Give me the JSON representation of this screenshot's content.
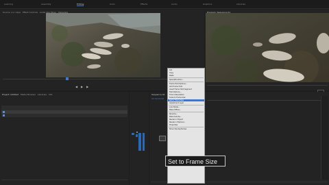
{
  "app": {
    "workspace_tabs": [
      "Learning",
      "Assembly",
      "Editing",
      "Color",
      "Effects",
      "Audio",
      "Graphics",
      "Libraries"
    ],
    "active_tab_index": 2
  },
  "source_monitor": {
    "tabs": [
      "Source: (no clips)",
      "Effect Controls",
      "Audio Clip Mixer",
      "Metadata"
    ]
  },
  "program_monitor": {
    "tabs": [
      "Program: Sequence 01"
    ]
  },
  "project": {
    "tabs": [
      "Project: Untitled",
      "Media Browser",
      "Libraries",
      "Info"
    ]
  },
  "timeline": {
    "tabs": [
      "Sequence 01"
    ],
    "timecode": "00:00:00:00"
  },
  "context_menu": {
    "items": [
      "Cut",
      "Copy",
      "Paste",
      "",
      "Speed/Duration...",
      "",
      "Frame Hold Options...",
      "Add Frame Hold",
      "Insert Frame Hold Segment",
      "Field Options...",
      "Time Interpolation",
      "Scale to Frame Size",
      "Set to Frame Size",
      "Adjustment Layer",
      "",
      "Link Media...",
      "Make Offline...",
      "",
      "Rename...",
      "Make Subclip...",
      "Reveal in Project",
      "Reveal in Explorer...",
      "Properties",
      "",
      "Show Clip Keyframes"
    ],
    "highlighted": "Set to Frame Size"
  },
  "tooltip": {
    "text": "Set to Frame Size"
  },
  "colors": {
    "accent": "#2c69b5",
    "highlight": "#3a77d3"
  }
}
